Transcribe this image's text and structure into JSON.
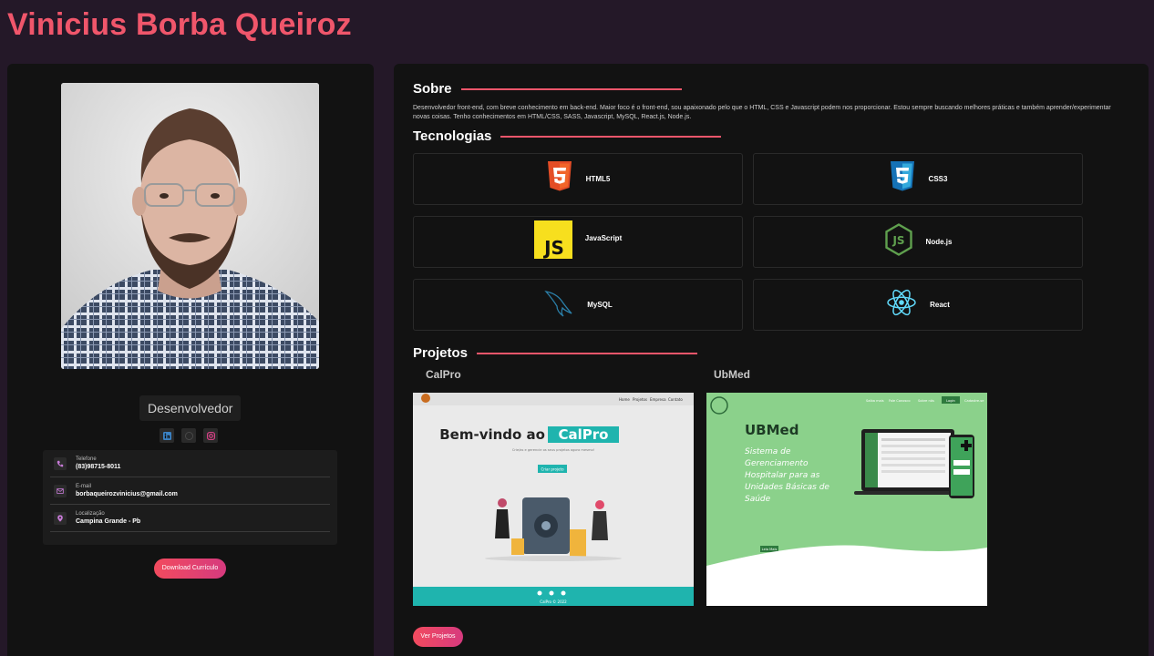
{
  "header": {
    "title": "Vinicius Borba Queiroz"
  },
  "profile": {
    "role": "Desenvolvedor",
    "socials": [
      "linkedin-icon",
      "github-icon",
      "instagram-icon"
    ],
    "contacts": [
      {
        "icon": "phone-icon",
        "label": "Telefone",
        "value": "(83)98715-8011"
      },
      {
        "icon": "mail-icon",
        "label": "E-mail",
        "value": "borbaqueirozvinicius@gmail.com"
      },
      {
        "icon": "location-icon",
        "label": "Localização",
        "value": "Campina Grande - Pb"
      }
    ],
    "download_label": "Download Currículo"
  },
  "about": {
    "title": "Sobre",
    "text": "Desenvolvedor front-end, com breve conhecimento em back-end. Maior foco é o front-end, sou apaixonado pelo que o HTML, CSS e Javascript podem nos proporcionar. Estou sempre buscando melhores práticas e também aprender/experimentar novas coisas. Tenho conhecimentos em HTML/CSS, SASS, Javascript, MySQL, React.js, Node.js."
  },
  "technologies": {
    "title": "Tecnologias",
    "items": [
      {
        "name": "HTML5",
        "icon": "html5-icon"
      },
      {
        "name": "CSS3",
        "icon": "css3-icon"
      },
      {
        "name": "JavaScript",
        "icon": "javascript-icon"
      },
      {
        "name": "Node.js",
        "icon": "nodejs-icon"
      },
      {
        "name": "MySQL",
        "icon": "mysql-icon"
      },
      {
        "name": "React",
        "icon": "react-icon"
      }
    ]
  },
  "projects": {
    "title": "Projetos",
    "items": [
      {
        "name": "CalPro",
        "preview": {
          "nav": [
            "Home",
            "Projetos",
            "Empresa",
            "Contato"
          ],
          "heading_a": "Bem-vindo ao",
          "heading_b": "CalPro",
          "tagline": "Crie/as e gerencie os seus projetos agora mesmo!",
          "cta": "Criar projeto",
          "footer": "CalPro © 2022"
        }
      },
      {
        "name": "UbMed",
        "preview": {
          "nav": [
            "Saiba mais",
            "Fale Conosco",
            "Sobre nós",
            "Login",
            "Cadastre-se"
          ],
          "heading": "UBMed",
          "subtitle_lines": [
            "Sistema de",
            "Gerenciamento",
            "Hospitalar para as",
            "Unidades Básicas de",
            "Saúde"
          ],
          "cta": "Leia Mais"
        }
      }
    ],
    "button_label": "Ver Projetos"
  },
  "colors": {
    "accent": "#f0566b",
    "background": "#241828",
    "card": "#121212",
    "calpro_teal": "#1fb4ae",
    "ubmed_green": "#8bd18b"
  }
}
